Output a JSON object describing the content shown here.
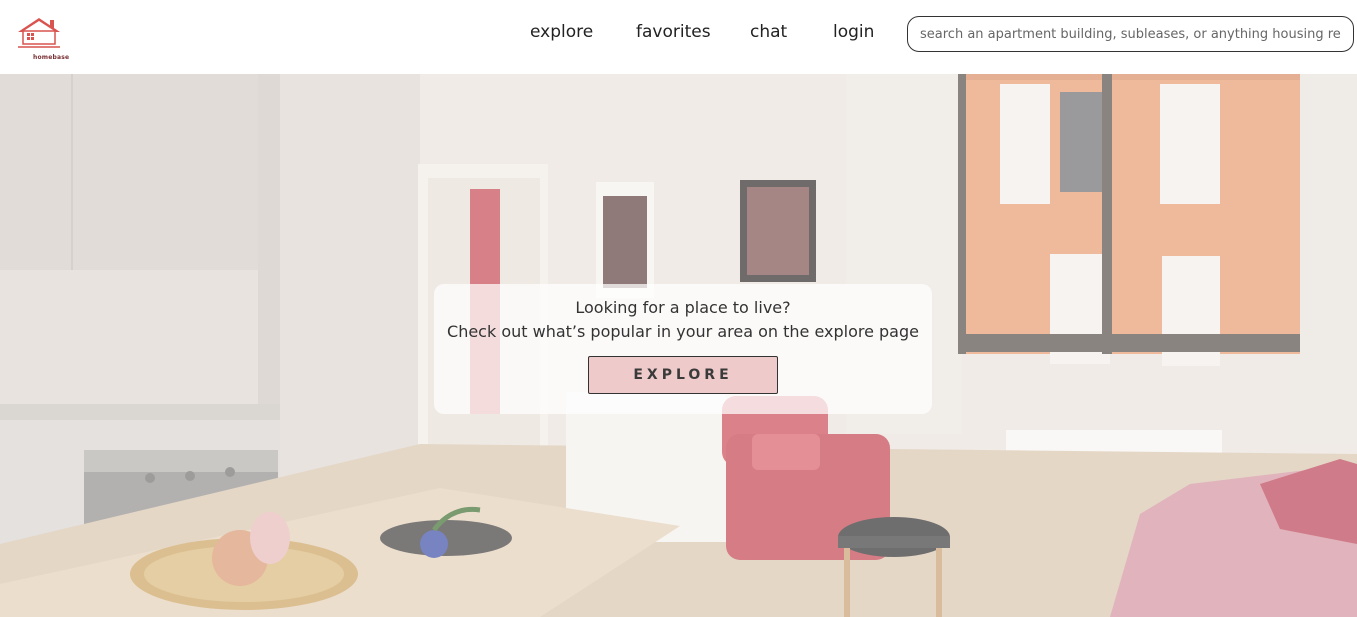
{
  "brand": {
    "name": "homebase",
    "logo_icon": "house-icon",
    "accent_color": "#d9534f"
  },
  "nav": {
    "items": [
      {
        "label": "explore"
      },
      {
        "label": "favorites"
      },
      {
        "label": "chat"
      },
      {
        "label": "login"
      }
    ]
  },
  "search": {
    "placeholder": "search an apartment building, subleases, or anything housing related",
    "value": ""
  },
  "hero": {
    "line1": "Looking for a place to live?",
    "line2": "Check out what’s popular in your area on the explore page",
    "button_label": "EXPLORE",
    "button_color": "#eecacb"
  }
}
